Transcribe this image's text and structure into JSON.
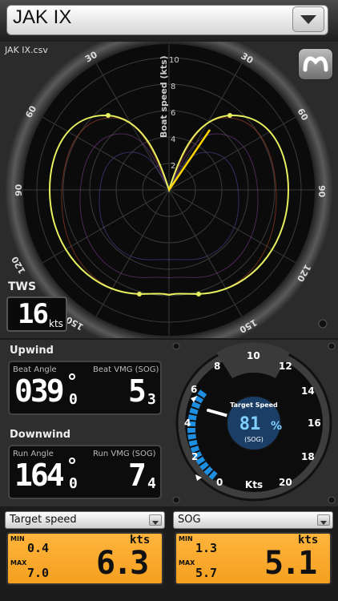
{
  "header": {
    "title": "JAK IX",
    "dropdown_icon": "triangle-down-icon"
  },
  "polar": {
    "file": "JAK IX.csv",
    "axis_label": "Boat speed (kts)",
    "speed_ticks": [
      "2",
      "4",
      "6",
      "8",
      "10"
    ],
    "angle_labels": {
      "a30": "30",
      "a60": "60",
      "a90": "90",
      "a120": "120",
      "a150": "150"
    },
    "logo_icon": "brand-logo-icon"
  },
  "tws": {
    "label": "TWS",
    "value": "16",
    "unit": "kts"
  },
  "upwind": {
    "title": "Upwind",
    "angle_label": "Beat Angle",
    "angle_value": "039",
    "angle_decimal": "0",
    "vmg_label": "Beat VMG",
    "vmg_sub": "(SOG)",
    "vmg_value": "5",
    "vmg_decimal": "3"
  },
  "downwind": {
    "title": "Downwind",
    "angle_label": "Run Angle",
    "angle_value": "164",
    "angle_decimal": "0",
    "vmg_label": "Run VMG",
    "vmg_sub": "(SOG)",
    "vmg_value": "7",
    "vmg_decimal": "4"
  },
  "gauge": {
    "ticks": [
      "0",
      "2",
      "4",
      "6",
      "8",
      "10",
      "12",
      "14",
      "16",
      "18",
      "20"
    ],
    "unit": "Kts",
    "center_title": "Target Speed",
    "center_value": "81",
    "center_unit": "%",
    "center_sub": "(SOG)"
  },
  "bottom_left": {
    "selector": "Target speed",
    "min_label": "MIN",
    "min_value": "0.4",
    "max_label": "MAX",
    "max_value": "7.0",
    "unit": "kts",
    "value": "6.3"
  },
  "bottom_right": {
    "selector": "SOG",
    "min_label": "MIN",
    "min_value": "1.3",
    "max_label": "MAX",
    "max_value": "5.7",
    "unit": "kts",
    "value": "5.1"
  },
  "colors": {
    "polar_curve": "#e8f060",
    "vmg_line": "#ffd500",
    "gauge_blue": "#1e8fe0",
    "lcd_orange": "#f6a828"
  }
}
